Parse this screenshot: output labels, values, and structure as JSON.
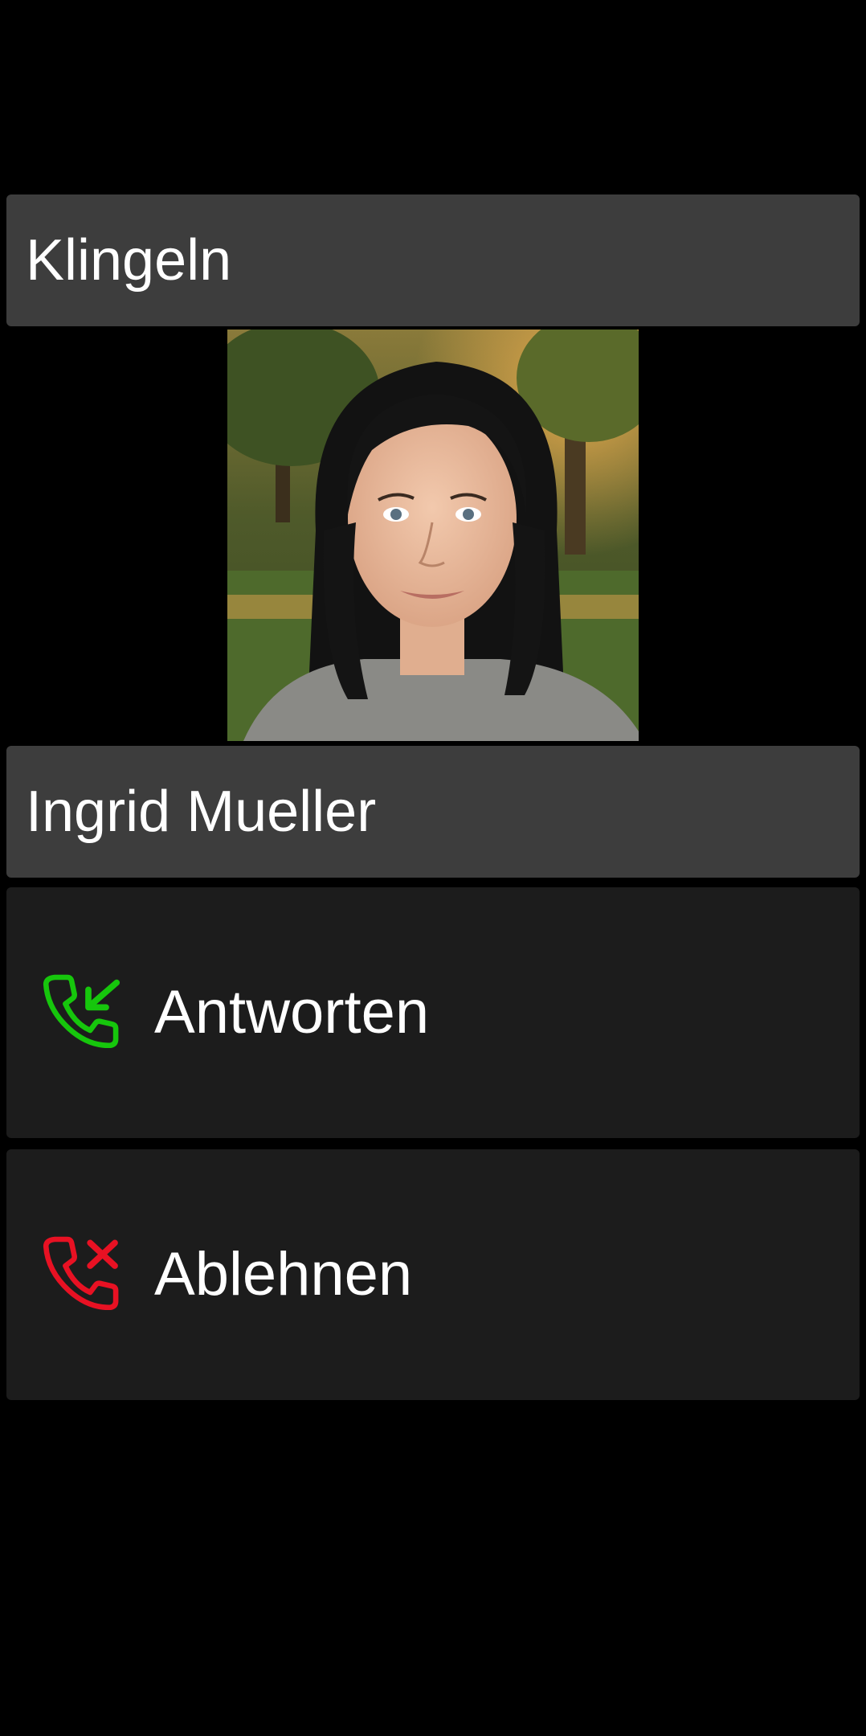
{
  "call": {
    "status_title": "Klingeln",
    "caller_name": "Ingrid Mueller"
  },
  "actions": {
    "answer": {
      "label": "Antworten",
      "icon": "phone-incoming-icon",
      "color": "#16c60c"
    },
    "reject": {
      "label": "Ablehnen",
      "icon": "phone-decline-icon",
      "color": "#e81123"
    }
  },
  "colors": {
    "background": "#000000",
    "title_bar": "#3d3d3d",
    "button": "#1c1c1c",
    "text": "#ffffff"
  }
}
